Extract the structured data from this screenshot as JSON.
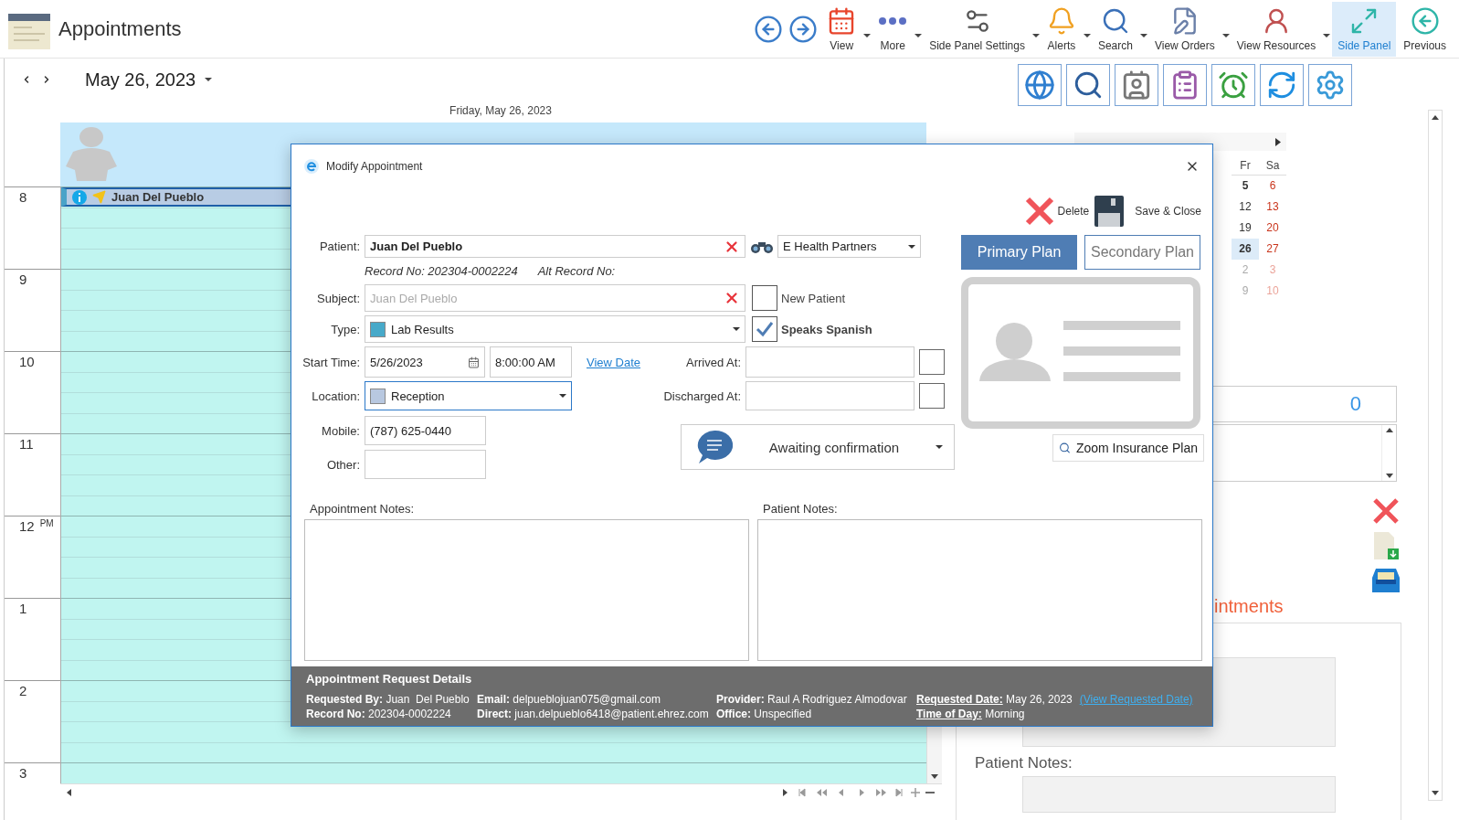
{
  "window": {
    "title": "Appointments"
  },
  "toolbar": {
    "items": [
      {
        "label": "View",
        "dropdown": true,
        "selected": false
      },
      {
        "label": "More",
        "dropdown": true,
        "selected": false
      },
      {
        "label": "Side Panel Settings",
        "dropdown": true,
        "selected": false
      },
      {
        "label": "Alerts",
        "dropdown": true,
        "selected": false
      },
      {
        "label": "Search",
        "dropdown": true,
        "selected": false
      },
      {
        "label": "View Orders",
        "dropdown": true,
        "selected": false
      },
      {
        "label": "View Resources",
        "dropdown": true,
        "selected": false
      },
      {
        "label": "Side Panel",
        "dropdown": false,
        "selected": true
      },
      {
        "label": "Previous",
        "dropdown": false,
        "selected": false
      }
    ]
  },
  "calendar": {
    "date": "May 26, 2023",
    "day_header": "Friday, May 26, 2023",
    "hours": [
      {
        "hour": "8"
      },
      {
        "hour": "9"
      },
      {
        "hour": "10"
      },
      {
        "hour": "11"
      },
      {
        "hour": "12",
        "suffix": "PM"
      },
      {
        "hour": "1"
      },
      {
        "hour": "2"
      },
      {
        "hour": "3"
      }
    ],
    "appointment": {
      "title": "Juan Del Pueblo"
    }
  },
  "side_panel": {
    "mini_calendar": {
      "columns": [
        {
          "header": "Fr",
          "kind": "weekday",
          "days": [
            {
              "text": "5",
              "bold": true,
              "other_month": false,
              "selected": false
            },
            {
              "text": "12",
              "bold": false,
              "other_month": false,
              "selected": false
            },
            {
              "text": "19",
              "bold": false,
              "other_month": false,
              "selected": false
            },
            {
              "text": "26",
              "bold": true,
              "other_month": false,
              "selected": true
            },
            {
              "text": "2",
              "bold": false,
              "other_month": true,
              "selected": false
            },
            {
              "text": "9",
              "bold": false,
              "other_month": true,
              "selected": false
            }
          ]
        },
        {
          "header": "Sa",
          "kind": "weekend",
          "days": [
            {
              "text": "6",
              "bold": false,
              "other_month": false,
              "selected": false
            },
            {
              "text": "13",
              "bold": false,
              "other_month": false,
              "selected": false
            },
            {
              "text": "20",
              "bold": false,
              "other_month": false,
              "selected": false
            },
            {
              "text": "27",
              "bold": false,
              "other_month": false,
              "selected": false
            },
            {
              "text": "3",
              "bold": false,
              "other_month": true,
              "selected": false
            },
            {
              "text": "10",
              "bold": false,
              "other_month": true,
              "selected": false
            }
          ]
        }
      ]
    },
    "count": "0",
    "partial_title": "intments",
    "patient_notes_label": "Patient Notes:"
  },
  "dialog": {
    "title": "Modify Appointment",
    "actions": [
      {
        "label": "Delete"
      },
      {
        "label": "Save & Close"
      }
    ],
    "patient": {
      "label": "Patient:",
      "value": "Juan Del Pueblo"
    },
    "record_no": "Record No: 202304-0002224",
    "alt_record_no": "Alt Record No:",
    "insurer": "E Health Partners",
    "subject": {
      "label": "Subject:",
      "placeholder": "Juan Del Pueblo"
    },
    "new_patient": {
      "label": "New Patient",
      "checked": false
    },
    "type": {
      "label": "Type:",
      "value": "Lab Results"
    },
    "speaks_spanish": {
      "label": "Speaks Spanish",
      "checked": true
    },
    "start_time": {
      "label": "Start Time:",
      "date": "5/26/2023",
      "time": "8:00:00 AM",
      "link": "View Date"
    },
    "arrived": {
      "label": "Arrived At:",
      "checked": false
    },
    "location": {
      "label": "Location:",
      "value": "Reception"
    },
    "discharged": {
      "label": "Discharged At:",
      "checked": false
    },
    "mobile": {
      "label": "Mobile:",
      "value": "(787) 625-0440"
    },
    "other": {
      "label": "Other:"
    },
    "status": "Awaiting confirmation",
    "plan_tabs": [
      {
        "label": "Primary Plan",
        "selected": true
      },
      {
        "label": "Secondary Plan",
        "selected": false
      }
    ],
    "zoom_button": "Zoom Insurance Plan",
    "appointment_notes_label": "Appointment Notes:",
    "patient_notes_label": "Patient Notes:",
    "footer": {
      "title": "Appointment Request Details",
      "columns": [
        {
          "lines": [
            {
              "label": "Requested By:",
              "value": "Juan  Del Pueblo",
              "underline": false
            },
            {
              "label": "Record No:",
              "value": "202304-0002224",
              "underline": false
            }
          ]
        },
        {
          "lines": [
            {
              "label": "Email:",
              "value": "delpueblojuan075@gmail.com",
              "underline": false
            },
            {
              "label": "Direct:",
              "value": "juan.delpueblo6418@patient.ehrez.com",
              "underline": false
            }
          ]
        },
        {
          "lines": [
            {
              "label": "Provider:",
              "value": "Raul A Rodriguez Almodovar",
              "underline": false
            },
            {
              "label": "Office:",
              "value": "Unspecified",
              "underline": false
            }
          ]
        },
        {
          "lines": [
            {
              "label": "Requested Date:",
              "value": "May 26, 2023",
              "underline": true,
              "link": "(View Requested Date)"
            },
            {
              "label": "Time of Day:",
              "value": "Morning",
              "underline": true
            }
          ]
        }
      ]
    }
  }
}
